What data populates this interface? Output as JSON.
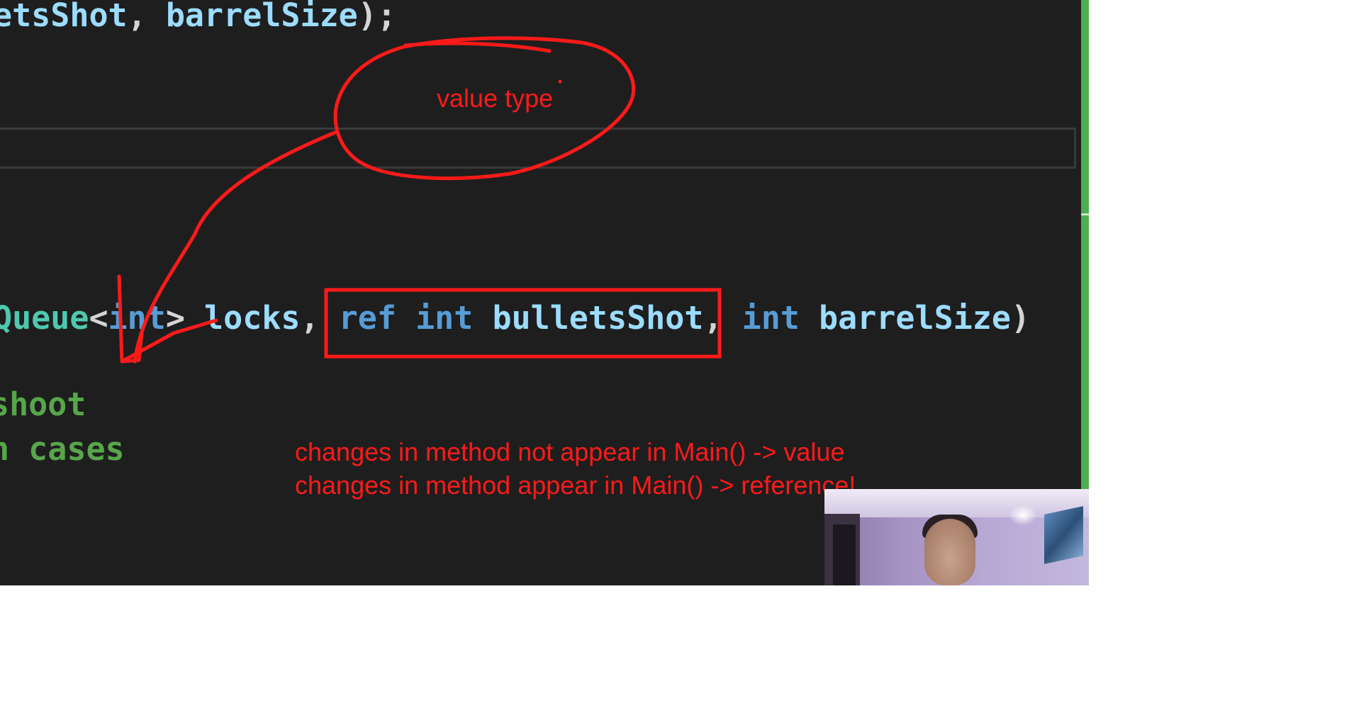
{
  "code": {
    "line1": [
      {
        "text": "etsShot",
        "cls": "tok-param"
      },
      {
        "text": ", ",
        "cls": "tok-default"
      },
      {
        "text": "barrelSize",
        "cls": "tok-param"
      },
      {
        "text": ");",
        "cls": "tok-default"
      }
    ],
    "line2": [
      {
        "text": "Queue",
        "cls": "tok-type"
      },
      {
        "text": "<",
        "cls": "tok-default"
      },
      {
        "text": "int",
        "cls": "tok-kw"
      },
      {
        "text": "> ",
        "cls": "tok-default"
      },
      {
        "text": "locks",
        "cls": "tok-param"
      },
      {
        "text": ", ",
        "cls": "tok-default"
      },
      {
        "text": "ref",
        "cls": "tok-kw"
      },
      {
        "text": " ",
        "cls": "tok-default"
      },
      {
        "text": "int",
        "cls": "tok-kw"
      },
      {
        "text": " ",
        "cls": "tok-default"
      },
      {
        "text": "bulletsShot",
        "cls": "tok-param"
      },
      {
        "text": ", ",
        "cls": "tok-default"
      },
      {
        "text": "int",
        "cls": "tok-kw"
      },
      {
        "text": " ",
        "cls": "tok-default"
      },
      {
        "text": "barrelSize",
        "cls": "tok-param"
      },
      {
        "text": ")",
        "cls": "tok-default"
      }
    ],
    "comment1": "shoot",
    "comment2": "n cases"
  },
  "annotations": {
    "bubble_label": "value type",
    "note_line1": "changes in method not appear in Main() -> value",
    "note_line2": "changes in method appear in Main() -> reference!"
  },
  "colors": {
    "editor_bg": "#1e1e1e",
    "annotation_red": "#ff1a1a",
    "scrollbar_green": "#4caf50",
    "keyword_blue": "#569cd6",
    "param_lightblue": "#9cdcfe",
    "type_teal": "#4ec9b0",
    "comment_green": "#57a64a"
  }
}
